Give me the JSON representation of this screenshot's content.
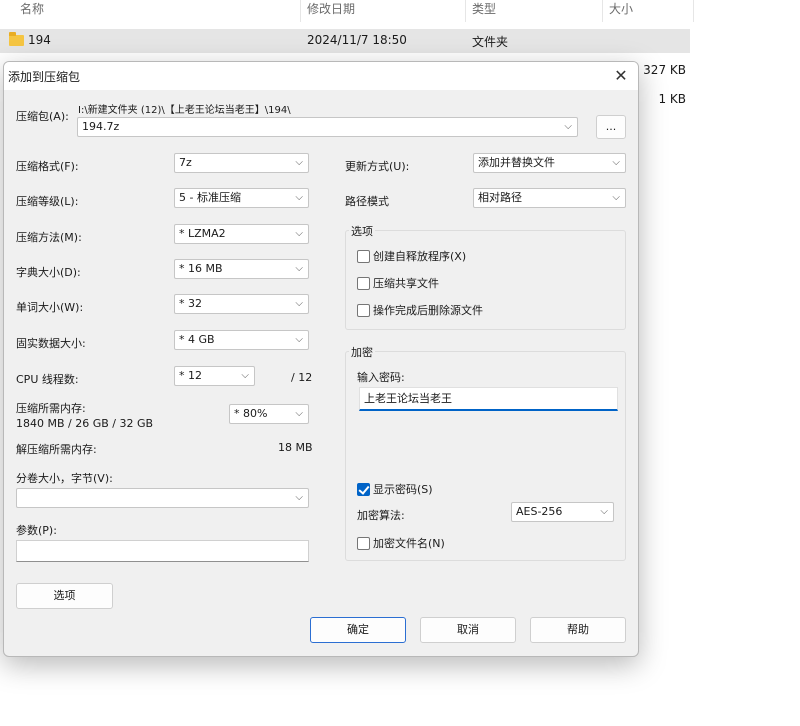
{
  "explorer": {
    "columns": {
      "name": "名称",
      "date": "修改日期",
      "type": "类型",
      "size": "大小"
    },
    "row": {
      "name": "194",
      "date": "2024/11/7 18:50",
      "type": "文件夹"
    },
    "sizes": [
      "327 KB",
      "1 KB"
    ]
  },
  "dialog": {
    "title": "添加到压缩包",
    "archive_label": "压缩包(A):",
    "archive_path": "I:\\新建文件夹 (12)\\【上老王论坛当老王】\\194\\",
    "archive_name": "194.7z",
    "browse_label": "...",
    "format_label": "压缩格式(F):",
    "format_value": "7z",
    "level_label": "压缩等级(L):",
    "level_value": "5 - 标准压缩",
    "method_label": "压缩方法(M):",
    "method_value": "* LZMA2",
    "dict_label": "字典大小(D):",
    "dict_value": "* 16 MB",
    "word_label": "单词大小(W):",
    "word_value": "* 32",
    "solid_label": "固实数据大小:",
    "solid_value": "* 4 GB",
    "cpu_label": "CPU 线程数:",
    "cpu_value": "* 12",
    "cpu_total": "/ 12",
    "mem_label": "压缩所需内存:",
    "mem_values": "1840 MB / 26 GB / 32 GB",
    "mem_percent": "* 80%",
    "decomp_label": "解压缩所需内存:",
    "decomp_value": "18 MB",
    "volume_label": "分卷大小，字节(V):",
    "volume_value": "",
    "params_label": "参数(P):",
    "params_value": "",
    "options_button": "选项",
    "update_label": "更新方式(U):",
    "update_value": "添加并替换文件",
    "path_label": "路径模式",
    "path_value": "相对路径",
    "options_group": "选项",
    "sfx_label": "创建自释放程序(X)",
    "shared_label": "压缩共享文件",
    "delete_label": "操作完成后删除源文件",
    "encrypt_group": "加密",
    "password_label": "输入密码:",
    "password_value": "上老王论坛当老王",
    "show_password_label": "显示密码(S)",
    "show_password_checked": true,
    "enc_method_label": "加密算法:",
    "enc_method_value": "AES-256",
    "encrypt_names_label": "加密文件名(N)",
    "ok_button": "确定",
    "cancel_button": "取消",
    "help_button": "帮助"
  },
  "colors": {
    "accent": "#0063c7",
    "dialog_bg": "#f0f0f0",
    "row_highlight": "#e5e5e5"
  }
}
